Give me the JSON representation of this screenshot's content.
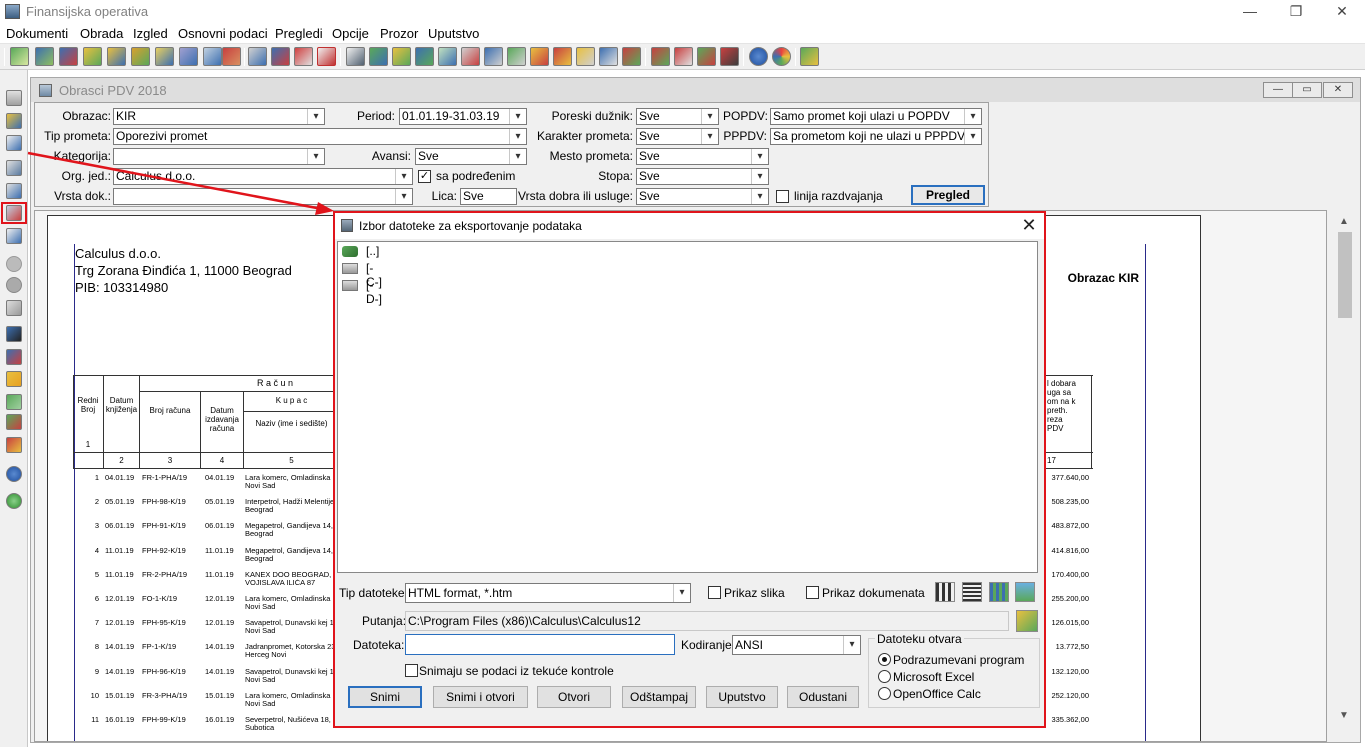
{
  "window": {
    "title": "Finansijska operativa",
    "controls": [
      "—",
      "❐",
      "✕"
    ]
  },
  "menu": [
    "Dokumenti",
    "Obrada",
    "Izgled",
    "Osnovni podaci",
    "Pregledi",
    "Opcije",
    "Prozor",
    "Uputstvo"
  ],
  "child": {
    "title": "Obrasci PDV 2018",
    "controls": [
      "—",
      "▭",
      "✕"
    ],
    "filters": {
      "obrazac_label": "Obrazac:",
      "obrazac_value": "KIR",
      "period_label": "Period:",
      "period_value": "01.01.19-31.03.19",
      "poreski_label": "Poreski dužnik:",
      "poreski_value": "Sve",
      "popdv_label": "POPDV:",
      "popdv_value": "Samo promet koji ulazi u POPDV",
      "tip_label": "Tip prometa:",
      "tip_value": "Oporezivi promet",
      "karakter_label": "Karakter prometa:",
      "karakter_value": "Sve",
      "pppdv_label": "PPPDV:",
      "pppdv_value": "Sa prometom koji ne ulazi u PPPDV",
      "kategorija_label": "Kategorija:",
      "kategorija_value": "",
      "avansi_label": "Avansi:",
      "avansi_value": "Sve",
      "mesto_label": "Mesto prometa:",
      "mesto_value": "Sve",
      "org_label": "Org. jed.:",
      "org_value": "Calculus d.o.o.",
      "sa_podredjenim_label": "sa podređenim",
      "stopa_label": "Stopa:",
      "stopa_value": "Sve",
      "vrsta_label": "Vrsta dok.:",
      "vrsta_value": "",
      "lica_label": "Lica:",
      "lica_value": "Sve",
      "vrsta_dobra_label": "Vrsta dobra ili usluge:",
      "vrsta_dobra_value": "Sve",
      "linija_label": "linija razdvajanja",
      "pregled_label": "Pregled"
    },
    "report": {
      "company_name": "Calculus d.o.o.",
      "company_address": "Trg Zorana Đinđića 1,  11000  Beograd",
      "company_pib": "PIB: 103314980",
      "form_title": "Obrazac KIR",
      "header_racun": "R a č u n",
      "header_kupac": "K u p a c",
      "col_redni": "Redni Broj",
      "col_redni_num": "1",
      "col_datum_knj": "Datum knjiženja",
      "col_broj_racuna": "Broj računa",
      "col_datum_izd": "Datum izdavanja računa",
      "col_naziv": "Naziv (ime i sedište)",
      "col_right": "l dobara uga sa om na k preth. reza PDV",
      "col_nums": [
        "2",
        "3",
        "4",
        "5",
        "17"
      ],
      "rows": [
        {
          "no": "1",
          "datum": "04.01.19",
          "broj": "FR-1-PHA/19",
          "izd": "04.01.19",
          "naziv": "Lara komerc, Omladinska",
          "naziv2": "Novi Sad",
          "iznos": "377.640,00"
        },
        {
          "no": "2",
          "datum": "05.01.19",
          "broj": "FPH-98-K/19",
          "izd": "05.01.19",
          "naziv": "Interpetrol, Hadži Melentije",
          "naziv2": "Beograd",
          "iznos": "508.235,00"
        },
        {
          "no": "3",
          "datum": "06.01.19",
          "broj": "FPH-91-K/19",
          "izd": "06.01.19",
          "naziv": "Megapetrol, Gandijeva 14,",
          "naziv2": "Beograd",
          "iznos": "483.872,00"
        },
        {
          "no": "4",
          "datum": "11.01.19",
          "broj": "FPH-92-K/19",
          "izd": "11.01.19",
          "naziv": "Megapetrol, Gandijeva 14,",
          "naziv2": "Beograd",
          "iznos": "414.816,00"
        },
        {
          "no": "5",
          "datum": "11.01.19",
          "broj": "FR-2-PHA/19",
          "izd": "11.01.19",
          "naziv": "KANEX DOO BEOGRAD,",
          "naziv2": "VOJISLAVA ILIĆA 87",
          "iznos": "170.400,00"
        },
        {
          "no": "6",
          "datum": "12.01.19",
          "broj": "FO-1-K/19",
          "izd": "12.01.19",
          "naziv": "Lara komerc, Omladinska",
          "naziv2": "Novi Sad",
          "iznos": "255.200,00"
        },
        {
          "no": "7",
          "datum": "12.01.19",
          "broj": "FPH-95-K/19",
          "izd": "12.01.19",
          "naziv": "Savapetrol, Dunavski kej 1",
          "naziv2": "Novi Sad",
          "iznos": "126.015,00"
        },
        {
          "no": "8",
          "datum": "14.01.19",
          "broj": "FP-1-K/19",
          "izd": "14.01.19",
          "naziv": "Jadranpromet, Kotorska 23",
          "naziv2": "Herceg Novi",
          "iznos": "13.772,50"
        },
        {
          "no": "9",
          "datum": "14.01.19",
          "broj": "FPH-96-K/19",
          "izd": "14.01.19",
          "naziv": "Savapetrol, Dunavski kej 1",
          "naziv2": "Novi Sad",
          "iznos": "132.120,00"
        },
        {
          "no": "10",
          "datum": "15.01.19",
          "broj": "FR-3-PHA/19",
          "izd": "15.01.19",
          "naziv": "Lara komerc, Omladinska",
          "naziv2": "Novi Sad",
          "iznos": "252.120,00"
        },
        {
          "no": "11",
          "datum": "16.01.19",
          "broj": "FPH-99-K/19",
          "izd": "16.01.19",
          "naziv": "Severpetrol, Nušićeva 18,",
          "naziv2": "Subotica",
          "iznos": "335.362,00"
        }
      ]
    }
  },
  "dialog": {
    "title": "Izbor datoteke za eksportovanje podataka",
    "close": "✕",
    "entries": [
      {
        "name": "[..]",
        "icon": "folder-up-icon"
      },
      {
        "name": "[-C-]",
        "icon": "drive-icon"
      },
      {
        "name": "[-D-]",
        "icon": "drive-icon"
      }
    ],
    "tip_label": "Tip datoteke:",
    "tip_value": "HTML format, *.htm",
    "prikaz_slika": "Prikaz slika",
    "prikaz_dokumenata": "Prikaz dokumenata",
    "putanja_label": "Putanja:",
    "putanja_value": "C:\\Program Files (x86)\\Calculus\\Calculus12",
    "datoteka_label": "Datoteka:",
    "datoteka_value": "",
    "kodiranje_label": "Kodiranje:",
    "kodiranje_value": "ANSI",
    "snimaju_label": "Snimaju se podaci iz tekuće kontrole",
    "opens_label": "Datoteku otvara",
    "opens_options": [
      "Podrazumevani program",
      "Microsoft Excel",
      "OpenOffice Calc"
    ],
    "buttons": [
      "Snimi",
      "Snimi i otvori",
      "Otvori",
      "Odštampaj",
      "Uputstvo",
      "Odustani"
    ]
  },
  "colors": {
    "annotation": "#e0141b",
    "accent": "#2a6fbf"
  }
}
